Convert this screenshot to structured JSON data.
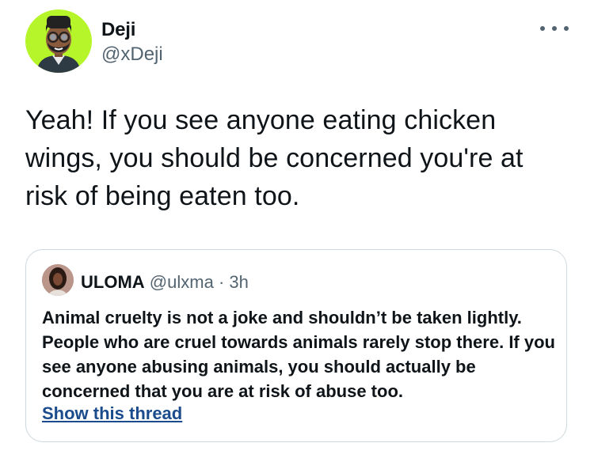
{
  "author": {
    "display_name": "Deji",
    "handle": "@xDeji",
    "avatar_icon": "bitmoji-avatar"
  },
  "more_icon": "more-dots-icon",
  "tweet": {
    "text": "Yeah! If you see anyone eating chicken wings, you should be concerned you're at risk of being eaten too."
  },
  "quoted": {
    "display_name": "ULOMA",
    "handle": "@ulxma",
    "separator": "·",
    "time": "3h",
    "text": "Animal cruelty is not a joke and shouldn’t be taken lightly. People who are cruel towards animals rarely stop there. If you see anyone abusing animals, you should actually be concerned that you are at risk of abuse too.",
    "thread_link": "Show this thread"
  },
  "colors": {
    "text": "#0f1419",
    "secondary": "#536471",
    "link": "#1a4b8c",
    "avatar_bg": "#b6f52a",
    "border": "#cfd9de"
  }
}
